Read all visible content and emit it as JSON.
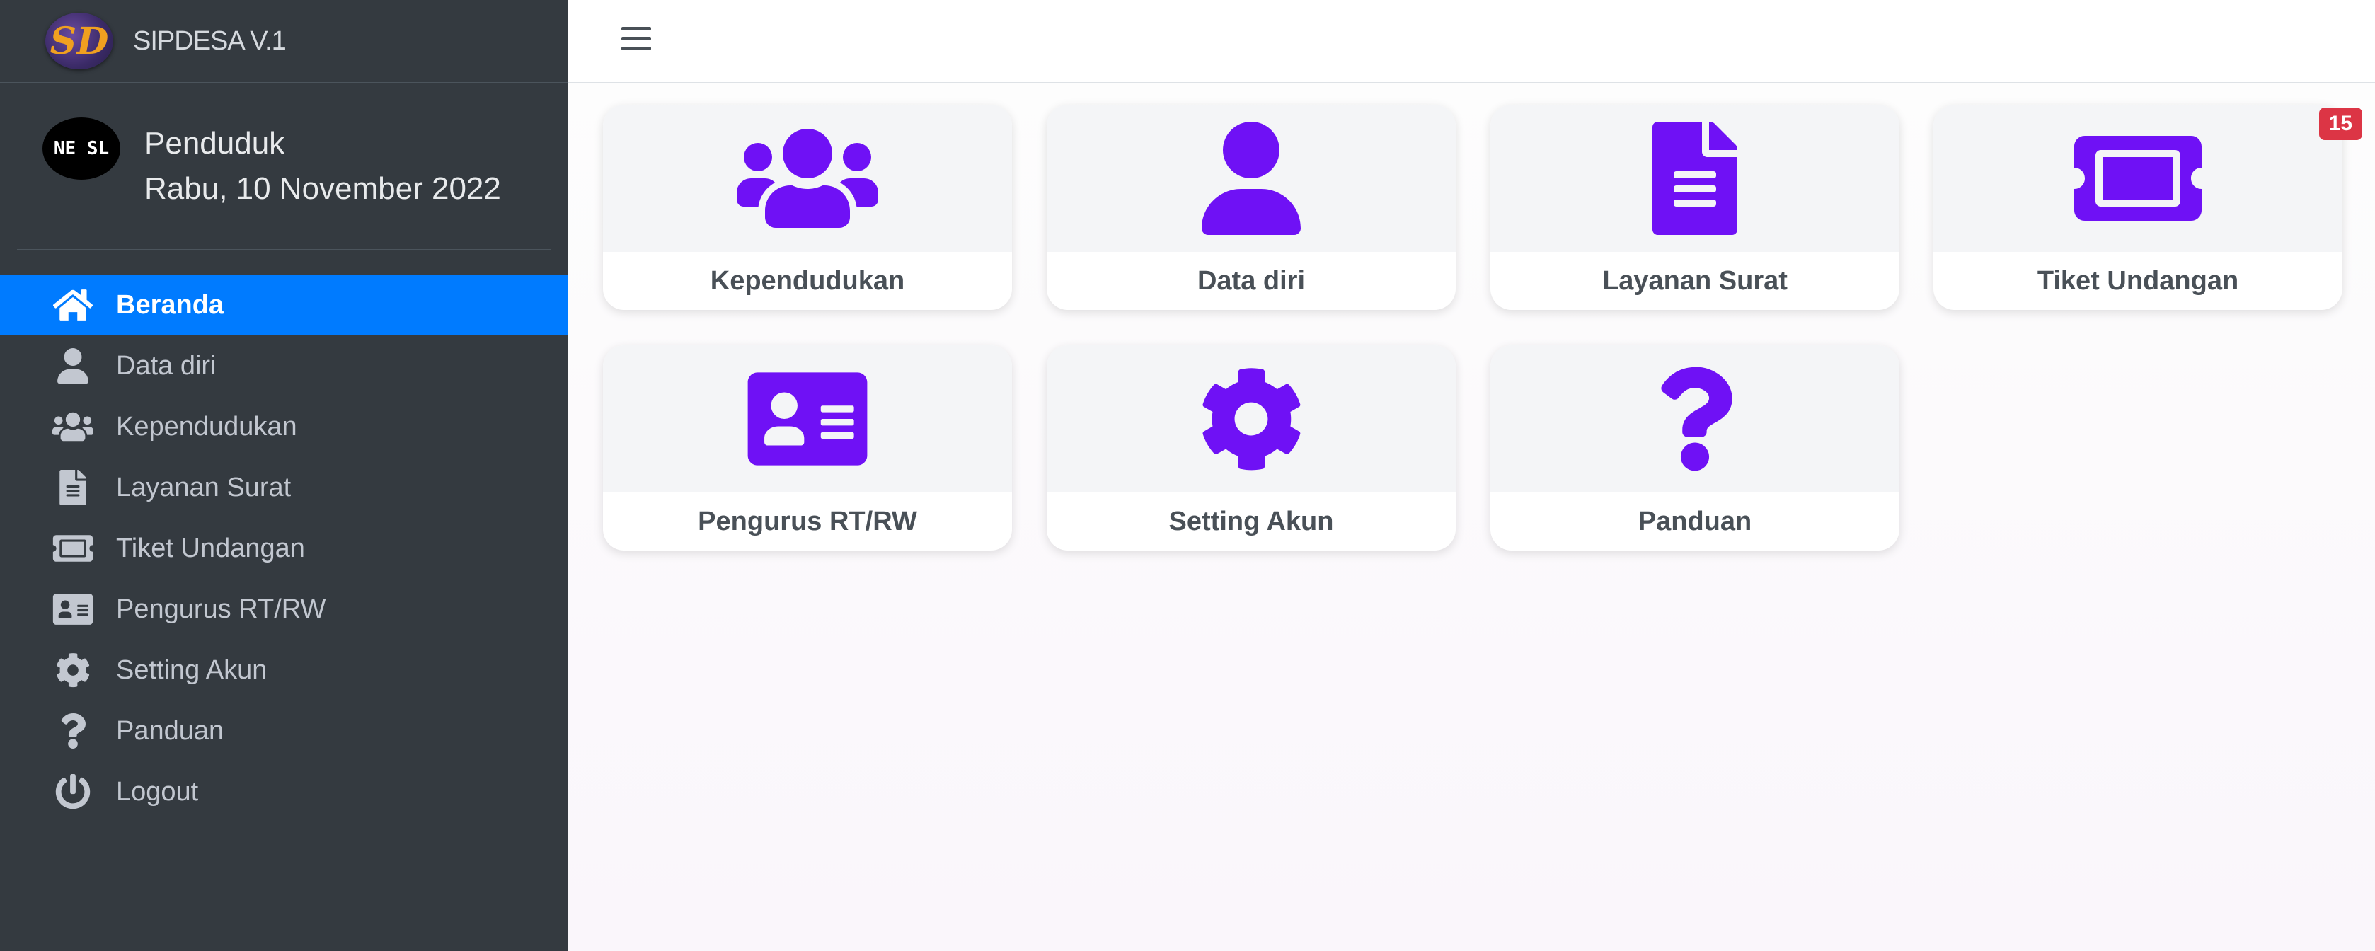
{
  "app": {
    "brand": "SIPDESA V.1",
    "logo_text": "SD"
  },
  "user": {
    "avatar_text": "NE SL",
    "name": "Penduduk",
    "date": "Rabu, 10 November 2022"
  },
  "nav": [
    {
      "label": "Beranda",
      "icon": "home-icon",
      "active": true
    },
    {
      "label": "Data diri",
      "icon": "user-icon"
    },
    {
      "label": "Kependudukan",
      "icon": "users-icon"
    },
    {
      "label": "Layanan Surat",
      "icon": "file-icon"
    },
    {
      "label": "Tiket Undangan",
      "icon": "ticket-icon"
    },
    {
      "label": "Pengurus RT/RW",
      "icon": "id-card-icon"
    },
    {
      "label": "Setting Akun",
      "icon": "gear-icon"
    },
    {
      "label": "Panduan",
      "icon": "question-icon"
    },
    {
      "label": "Logout",
      "icon": "power-icon"
    }
  ],
  "cards": [
    {
      "label": "Kependudukan",
      "icon": "users-icon"
    },
    {
      "label": "Data diri",
      "icon": "user-icon"
    },
    {
      "label": "Layanan Surat",
      "icon": "file-icon"
    },
    {
      "label": "Tiket Undangan",
      "icon": "ticket-icon",
      "badge": "15"
    },
    {
      "label": "Pengurus RT/RW",
      "icon": "id-card-icon"
    },
    {
      "label": "Setting Akun",
      "icon": "gear-icon"
    },
    {
      "label": "Panduan",
      "icon": "question-icon"
    }
  ],
  "colors": {
    "sidebar": "#343a40",
    "active": "#007bff",
    "icon_accent": "#6f11f5",
    "badge": "#dc3545"
  }
}
